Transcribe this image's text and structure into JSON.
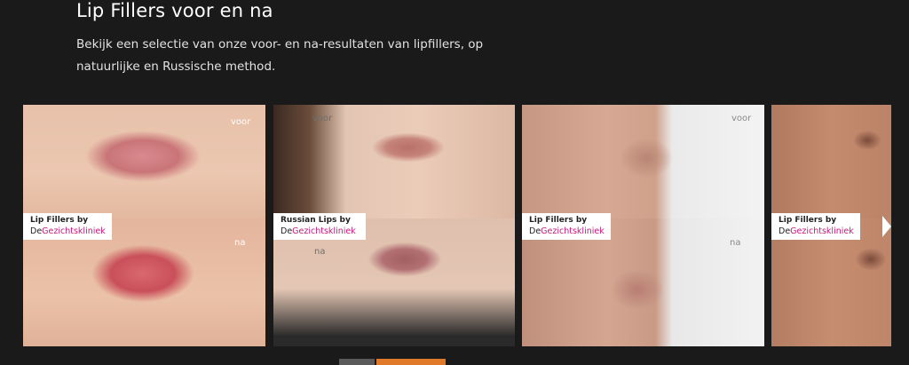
{
  "header": {
    "title": "Lip Fillers voor en na",
    "description": "Bekijk een selectie van onze voor- en na-resultaten van lipfillers, op natuurlijke en Russische method."
  },
  "gallery": [
    {
      "before_label": "voor",
      "after_label": "na",
      "badge_line1": "Lip Fillers by",
      "badge_prefix": "De",
      "badge_brand": "Gezichtskliniek"
    },
    {
      "before_label": "voor",
      "after_label": "na",
      "badge_line1": "Russian Lips by",
      "badge_prefix": "De",
      "badge_brand": "Gezichtskliniek"
    },
    {
      "before_label": "voor",
      "after_label": "na",
      "badge_line1": "Lip Fillers by",
      "badge_prefix": "De",
      "badge_brand": "Gezichtskliniek"
    },
    {
      "before_label": "",
      "after_label": "",
      "badge_line1": "Lip Fillers by",
      "badge_prefix": "De",
      "badge_brand": "Gezichtskliniek"
    }
  ],
  "colors": {
    "background": "#1a1a1a",
    "brand_pink": "#c2187a",
    "accent_orange": "#e07a2a"
  }
}
